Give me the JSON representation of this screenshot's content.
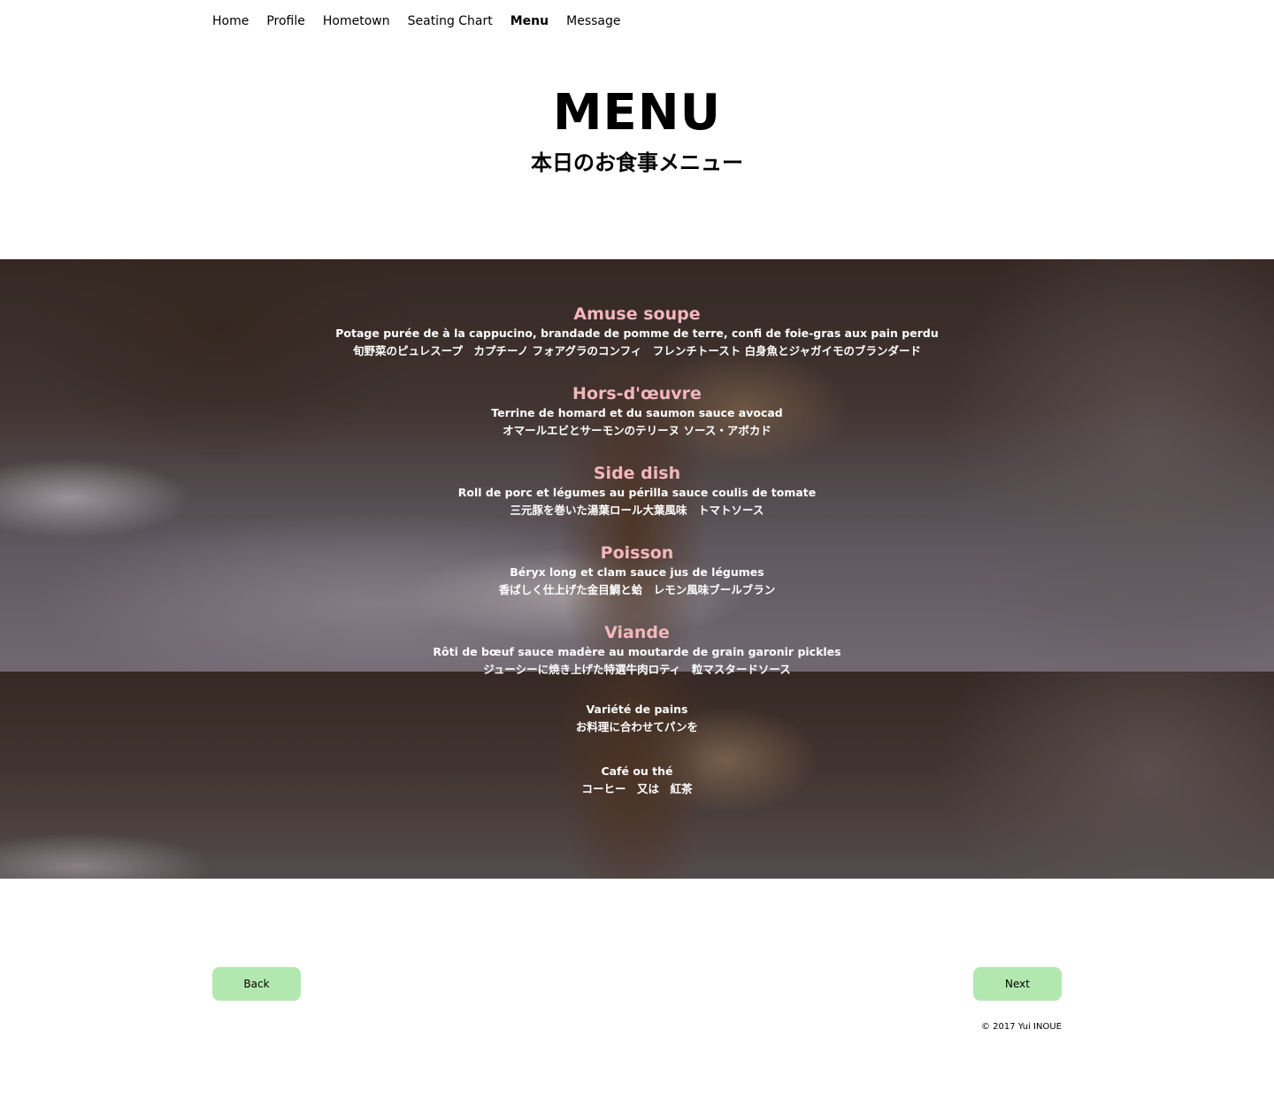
{
  "nav": {
    "items": [
      {
        "label": "Home",
        "active": false
      },
      {
        "label": "Profile",
        "active": false
      },
      {
        "label": "Hometown",
        "active": false
      },
      {
        "label": "Seating Chart",
        "active": false
      },
      {
        "label": "Menu",
        "active": true
      },
      {
        "label": "Message",
        "active": false
      }
    ]
  },
  "header": {
    "title": "MENU",
    "subtitle": "本日のお食事メニュー"
  },
  "menu": {
    "courses": [
      {
        "title": "Amuse soupe",
        "fr": "Potage purée de à la cappucino, brandade de pomme de terre, confi de foie-gras aux pain perdu",
        "ja": "旬野菜のピュレスープ　カプチーノ フォアグラのコンフィ　フレンチトースト 白身魚とジャガイモのブランダード"
      },
      {
        "title": "Hors-d'œuvre",
        "fr": "Terrine de homard et du saumon sauce avocad",
        "ja": "オマールエビとサーモンのテリーヌ ソース・アボカド"
      },
      {
        "title": "Side dish",
        "fr": "Roll de porc et légumes au périlla sauce coulis de tomate",
        "ja": "三元豚を巻いた湯葉ロール大葉風味　トマトソース"
      },
      {
        "title": "Poisson",
        "fr": "Béryx long et clam sauce jus de légumes",
        "ja": "香ばしく仕上げた金目鯛と蛤　レモン風味ブールブラン"
      },
      {
        "title": "Viande",
        "fr": "Rôti de bœuf sauce madère au moutarde de grain garonir pickles",
        "ja": "ジューシーに焼き上げた特選牛肉ロティ　粒マスタードソース"
      },
      {
        "title": "",
        "fr": "Variété de pains",
        "ja": "お料理に合わせてパンを"
      },
      {
        "title": "",
        "fr": "Café ou thé",
        "ja": "コーヒー　又は　紅茶"
      }
    ]
  },
  "buttons": {
    "back_label": "Back",
    "next_label": "Next",
    "color": "#b2e8b0"
  },
  "footer": {
    "copyright": "© 2017 Yui INOUE"
  },
  "colors": {
    "course_title": "#f4b6bd",
    "course_text": "#ffffff"
  }
}
